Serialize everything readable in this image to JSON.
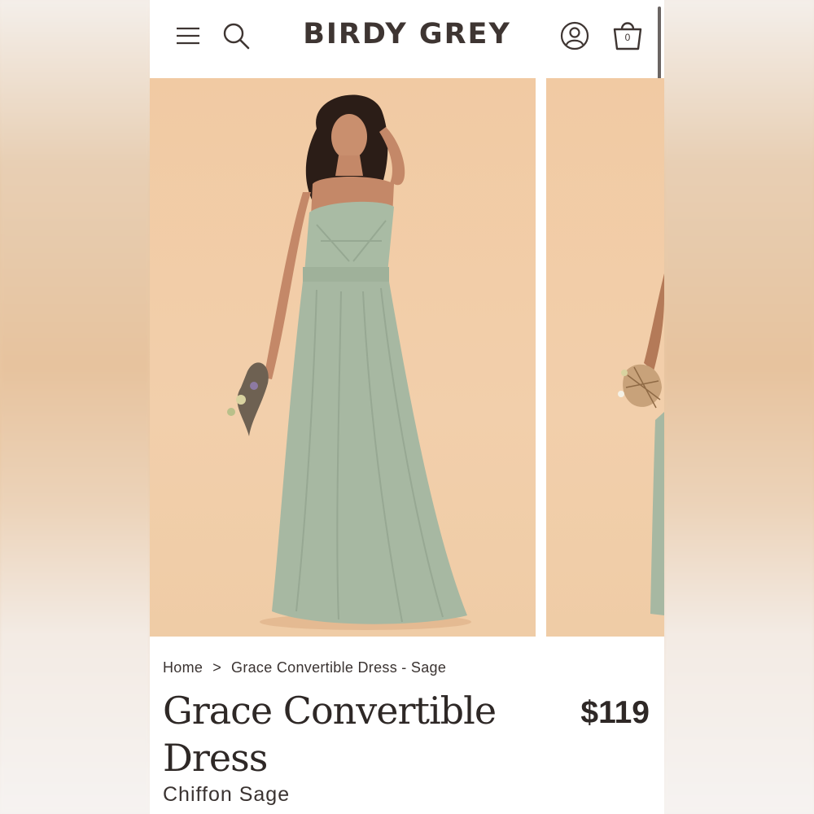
{
  "header": {
    "logo": "BIRDY GREY",
    "cart_count": "0",
    "icons": [
      "menu-icon",
      "search-icon",
      "account-icon",
      "bag-icon"
    ]
  },
  "gallery": {
    "background_color": "#f1caa3",
    "dress_color": "#a7b8a2"
  },
  "product": {
    "breadcrumb": {
      "home": "Home",
      "separator": ">",
      "current": "Grace Convertible Dress - Sage"
    },
    "title": "Grace Convertible Dress",
    "price": "$119",
    "subtitle": "Chiffon Sage"
  }
}
